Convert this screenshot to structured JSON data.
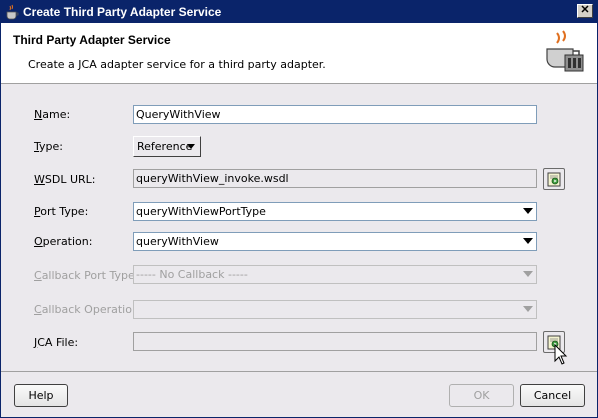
{
  "window": {
    "title": "Create Third Party Adapter Service",
    "close_glyph": "✕"
  },
  "header": {
    "title": "Third Party Adapter Service",
    "description": "Create a JCA adapter service for a third party adapter.",
    "icon": "adapter-coffee-icon"
  },
  "form": {
    "name": {
      "label_mnemonic": "N",
      "label_rest": "ame:",
      "value": "QueryWithView"
    },
    "type": {
      "label_mnemonic": "T",
      "label_rest": "ype:",
      "value": "Reference"
    },
    "wsdl_url": {
      "label_mnemonic": "W",
      "label_rest": "SDL URL:",
      "value": "queryWithView_invoke.wsdl"
    },
    "port_type": {
      "label_mnemonic": "P",
      "label_rest": "ort Type:",
      "value": "queryWithViewPortType"
    },
    "operation": {
      "label_mnemonic": "O",
      "label_rest": "peration:",
      "value": "queryWithView"
    },
    "callback_port_type": {
      "label_mnemonic": "C",
      "label_rest": "allback Port Type:",
      "value": "----- No Callback -----"
    },
    "callback_operation": {
      "label_mnemonic": "C",
      "label_rest": "allback Operation:",
      "value": ""
    },
    "jca_file": {
      "label_mnemonic": "J",
      "label_rest": "CA File:",
      "value": ""
    }
  },
  "buttons": {
    "help": "Help",
    "ok": "OK",
    "cancel": "Cancel"
  },
  "colors": {
    "titlebar": "#0a246a",
    "dialog_bg": "#ebe9ed",
    "disabled_text": "#a0a0a0"
  }
}
